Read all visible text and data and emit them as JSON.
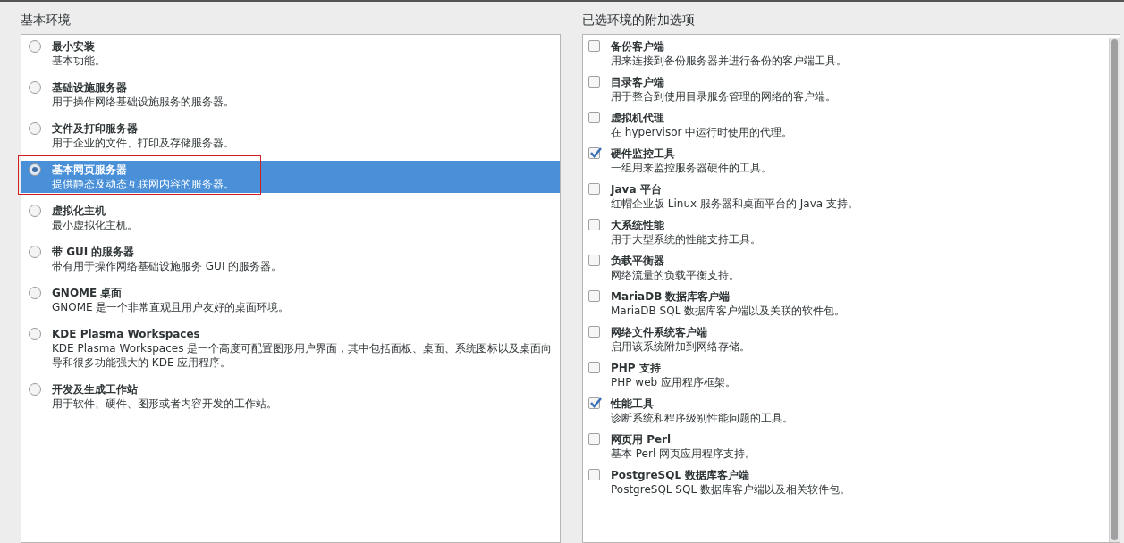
{
  "base_environment": {
    "title": "基本环境",
    "items": [
      {
        "name": "最小安装",
        "description": "基本功能。",
        "selected": false,
        "highlighted": false
      },
      {
        "name": "基础设施服务器",
        "description": "用于操作网络基础设施服务的服务器。",
        "selected": false,
        "highlighted": false
      },
      {
        "name": "文件及打印服务器",
        "description": "用于企业的文件、打印及存储服务器。",
        "selected": false,
        "highlighted": false
      },
      {
        "name": "基本网页服务器",
        "description": "提供静态及动态互联网内容的服务器。",
        "selected": true,
        "highlighted": true
      },
      {
        "name": "虚拟化主机",
        "description": "最小虚拟化主机。",
        "selected": false,
        "highlighted": false
      },
      {
        "name": "带 GUI 的服务器",
        "description": "带有用于操作网络基础设施服务 GUI 的服务器。",
        "selected": false,
        "highlighted": false
      },
      {
        "name": "GNOME 桌面",
        "description": "GNOME 是一个非常直观且用户友好的桌面环境。",
        "selected": false,
        "highlighted": false
      },
      {
        "name": "KDE Plasma Workspaces",
        "description": "KDE Plasma Workspaces 是一个高度可配置图形用户界面，其中包括面板、桌面、系统图标以及桌面向导和很多功能强大的 KDE 应用程序。",
        "selected": false,
        "highlighted": false
      },
      {
        "name": "开发及生成工作站",
        "description": "用于软件、硬件、图形或者内容开发的工作站。",
        "selected": false,
        "highlighted": false
      }
    ]
  },
  "addons": {
    "title": "已选环境的附加选项",
    "items": [
      {
        "name": "备份客户端",
        "description": "用来连接到备份服务器并进行备份的客户端工具。",
        "checked": false
      },
      {
        "name": "目录客户端",
        "description": "用于整合到使用目录服务管理的网络的客户端。",
        "checked": false
      },
      {
        "name": "虚拟机代理",
        "description": "在 hypervisor 中运行时使用的代理。",
        "checked": false
      },
      {
        "name": "硬件监控工具",
        "description": "一组用来监控服务器硬件的工具。",
        "checked": true
      },
      {
        "name": "Java 平台",
        "description": "红帽企业版 Linux 服务器和桌面平台的 Java 支持。",
        "checked": false
      },
      {
        "name": "大系统性能",
        "description": "用于大型系统的性能支持工具。",
        "checked": false
      },
      {
        "name": "负载平衡器",
        "description": "网络流量的负载平衡支持。",
        "checked": false
      },
      {
        "name": "MariaDB 数据库客户端",
        "description": "MariaDB SQL 数据库客户端以及关联的软件包。",
        "checked": false
      },
      {
        "name": "网络文件系统客户端",
        "description": "启用该系统附加到网络存储。",
        "checked": false
      },
      {
        "name": "PHP 支持",
        "description": "PHP web 应用程序框架。",
        "checked": false
      },
      {
        "name": "性能工具",
        "description": "诊断系统和程序级别性能问题的工具。",
        "checked": true
      },
      {
        "name": "网页用 Perl",
        "description": "基本 Perl 网页应用程序支持。",
        "checked": false
      },
      {
        "name": "PostgreSQL 数据库客户端",
        "description": "PostgreSQL SQL 数据库客户端以及相关软件包。",
        "checked": false
      }
    ]
  }
}
